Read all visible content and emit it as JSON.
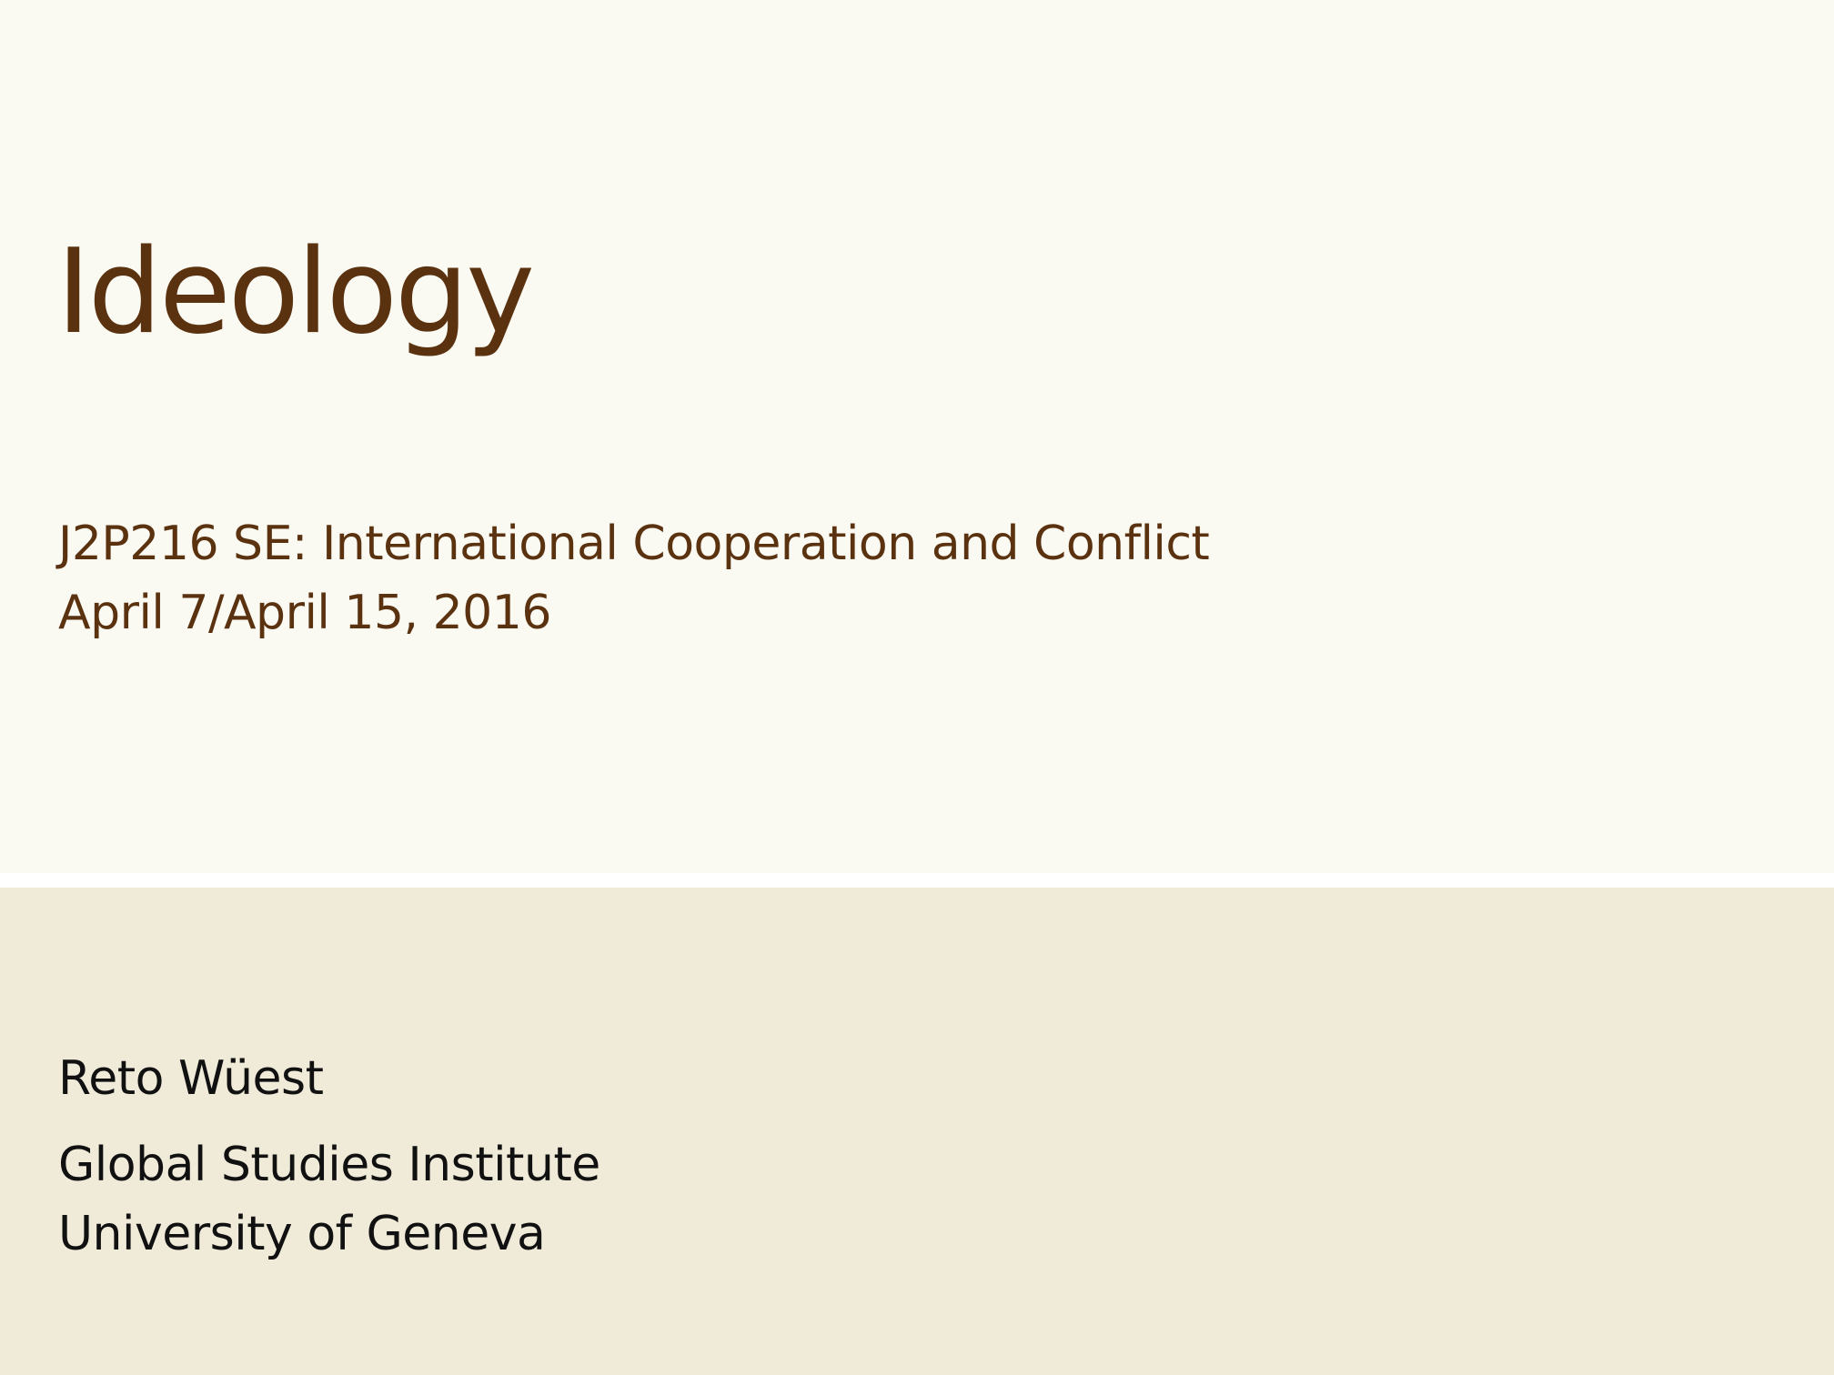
{
  "slide": {
    "title": "Ideology",
    "subtitle_lines": [
      "J2P216 SE: International Cooperation and Conflict",
      "April 7/April 15, 2016"
    ],
    "author": "Reto Wüest",
    "affiliation_lines": [
      "Global Studies Institute",
      "University of Geneva"
    ]
  },
  "colors": {
    "top_background": "#faf9f2",
    "bottom_background": "#f0ead8",
    "title_text": "#5a3210",
    "author_text": "#111111"
  }
}
